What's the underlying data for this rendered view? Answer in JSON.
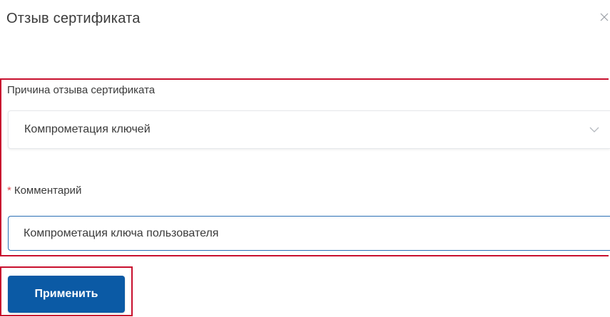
{
  "dialog": {
    "title": "Отзыв сертификата",
    "close_icon": "close-icon"
  },
  "form": {
    "reason": {
      "label": "Причина отзыва сертификата",
      "selected_value": "Компрометация ключей",
      "dropdown_icon": "chevron-down-icon"
    },
    "comment": {
      "required_mark": "*",
      "label": "Комментарий",
      "value": "Компрометация ключа пользователя"
    },
    "apply_label": "Применить"
  },
  "colors": {
    "primary_button": "#0b5aa5",
    "highlight_border": "#c8102e",
    "required_mark": "#e0474c",
    "input_focus_border": "#2a6fb5"
  }
}
